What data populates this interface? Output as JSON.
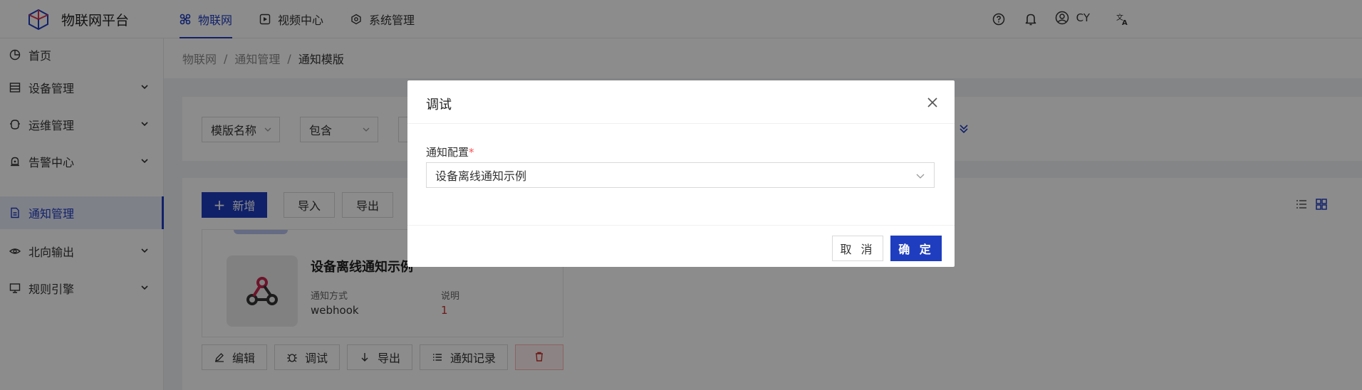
{
  "app": {
    "title": "物联网平台"
  },
  "topnav": [
    {
      "label": "物联网",
      "icon": "iot-icon",
      "active": true
    },
    {
      "label": "视频中心",
      "icon": "video-icon",
      "active": false
    },
    {
      "label": "系统管理",
      "icon": "system-icon",
      "active": false
    }
  ],
  "header": {
    "user": "CY"
  },
  "sidebar": {
    "items": [
      {
        "label": "首页",
        "icon": "pie-chart-icon"
      },
      {
        "label": "设备管理",
        "icon": "device-icon"
      },
      {
        "label": "运维管理",
        "icon": "ops-icon"
      },
      {
        "label": "告警中心",
        "icon": "alarm-icon"
      },
      {
        "label": "通知管理",
        "icon": "notice-icon",
        "active": true
      },
      {
        "label": "北向输出",
        "icon": "output-icon"
      },
      {
        "label": "规则引擎",
        "icon": "rule-icon"
      }
    ]
  },
  "breadcrumb": [
    "物联网",
    "通知管理",
    "通知模版"
  ],
  "filter": {
    "field": "模版名称",
    "operator": "包含"
  },
  "toolbar": {
    "add": "新增",
    "import": "导入",
    "export": "导出"
  },
  "card": {
    "title": "设备离线通知示例",
    "method_label": "通知方式",
    "method_value": "webhook",
    "desc_label": "说明",
    "desc_value": "1"
  },
  "actions": {
    "edit": "编辑",
    "debug": "调试",
    "export": "导出",
    "records": "通知记录"
  },
  "modal": {
    "title": "调试",
    "field_label": "通知配置",
    "required_mark": "*",
    "field_value": "设备离线通知示例",
    "cancel": "取 消",
    "ok": "确 定"
  },
  "colors": {
    "primary": "#1f3dbf",
    "danger": "#c9302c"
  }
}
